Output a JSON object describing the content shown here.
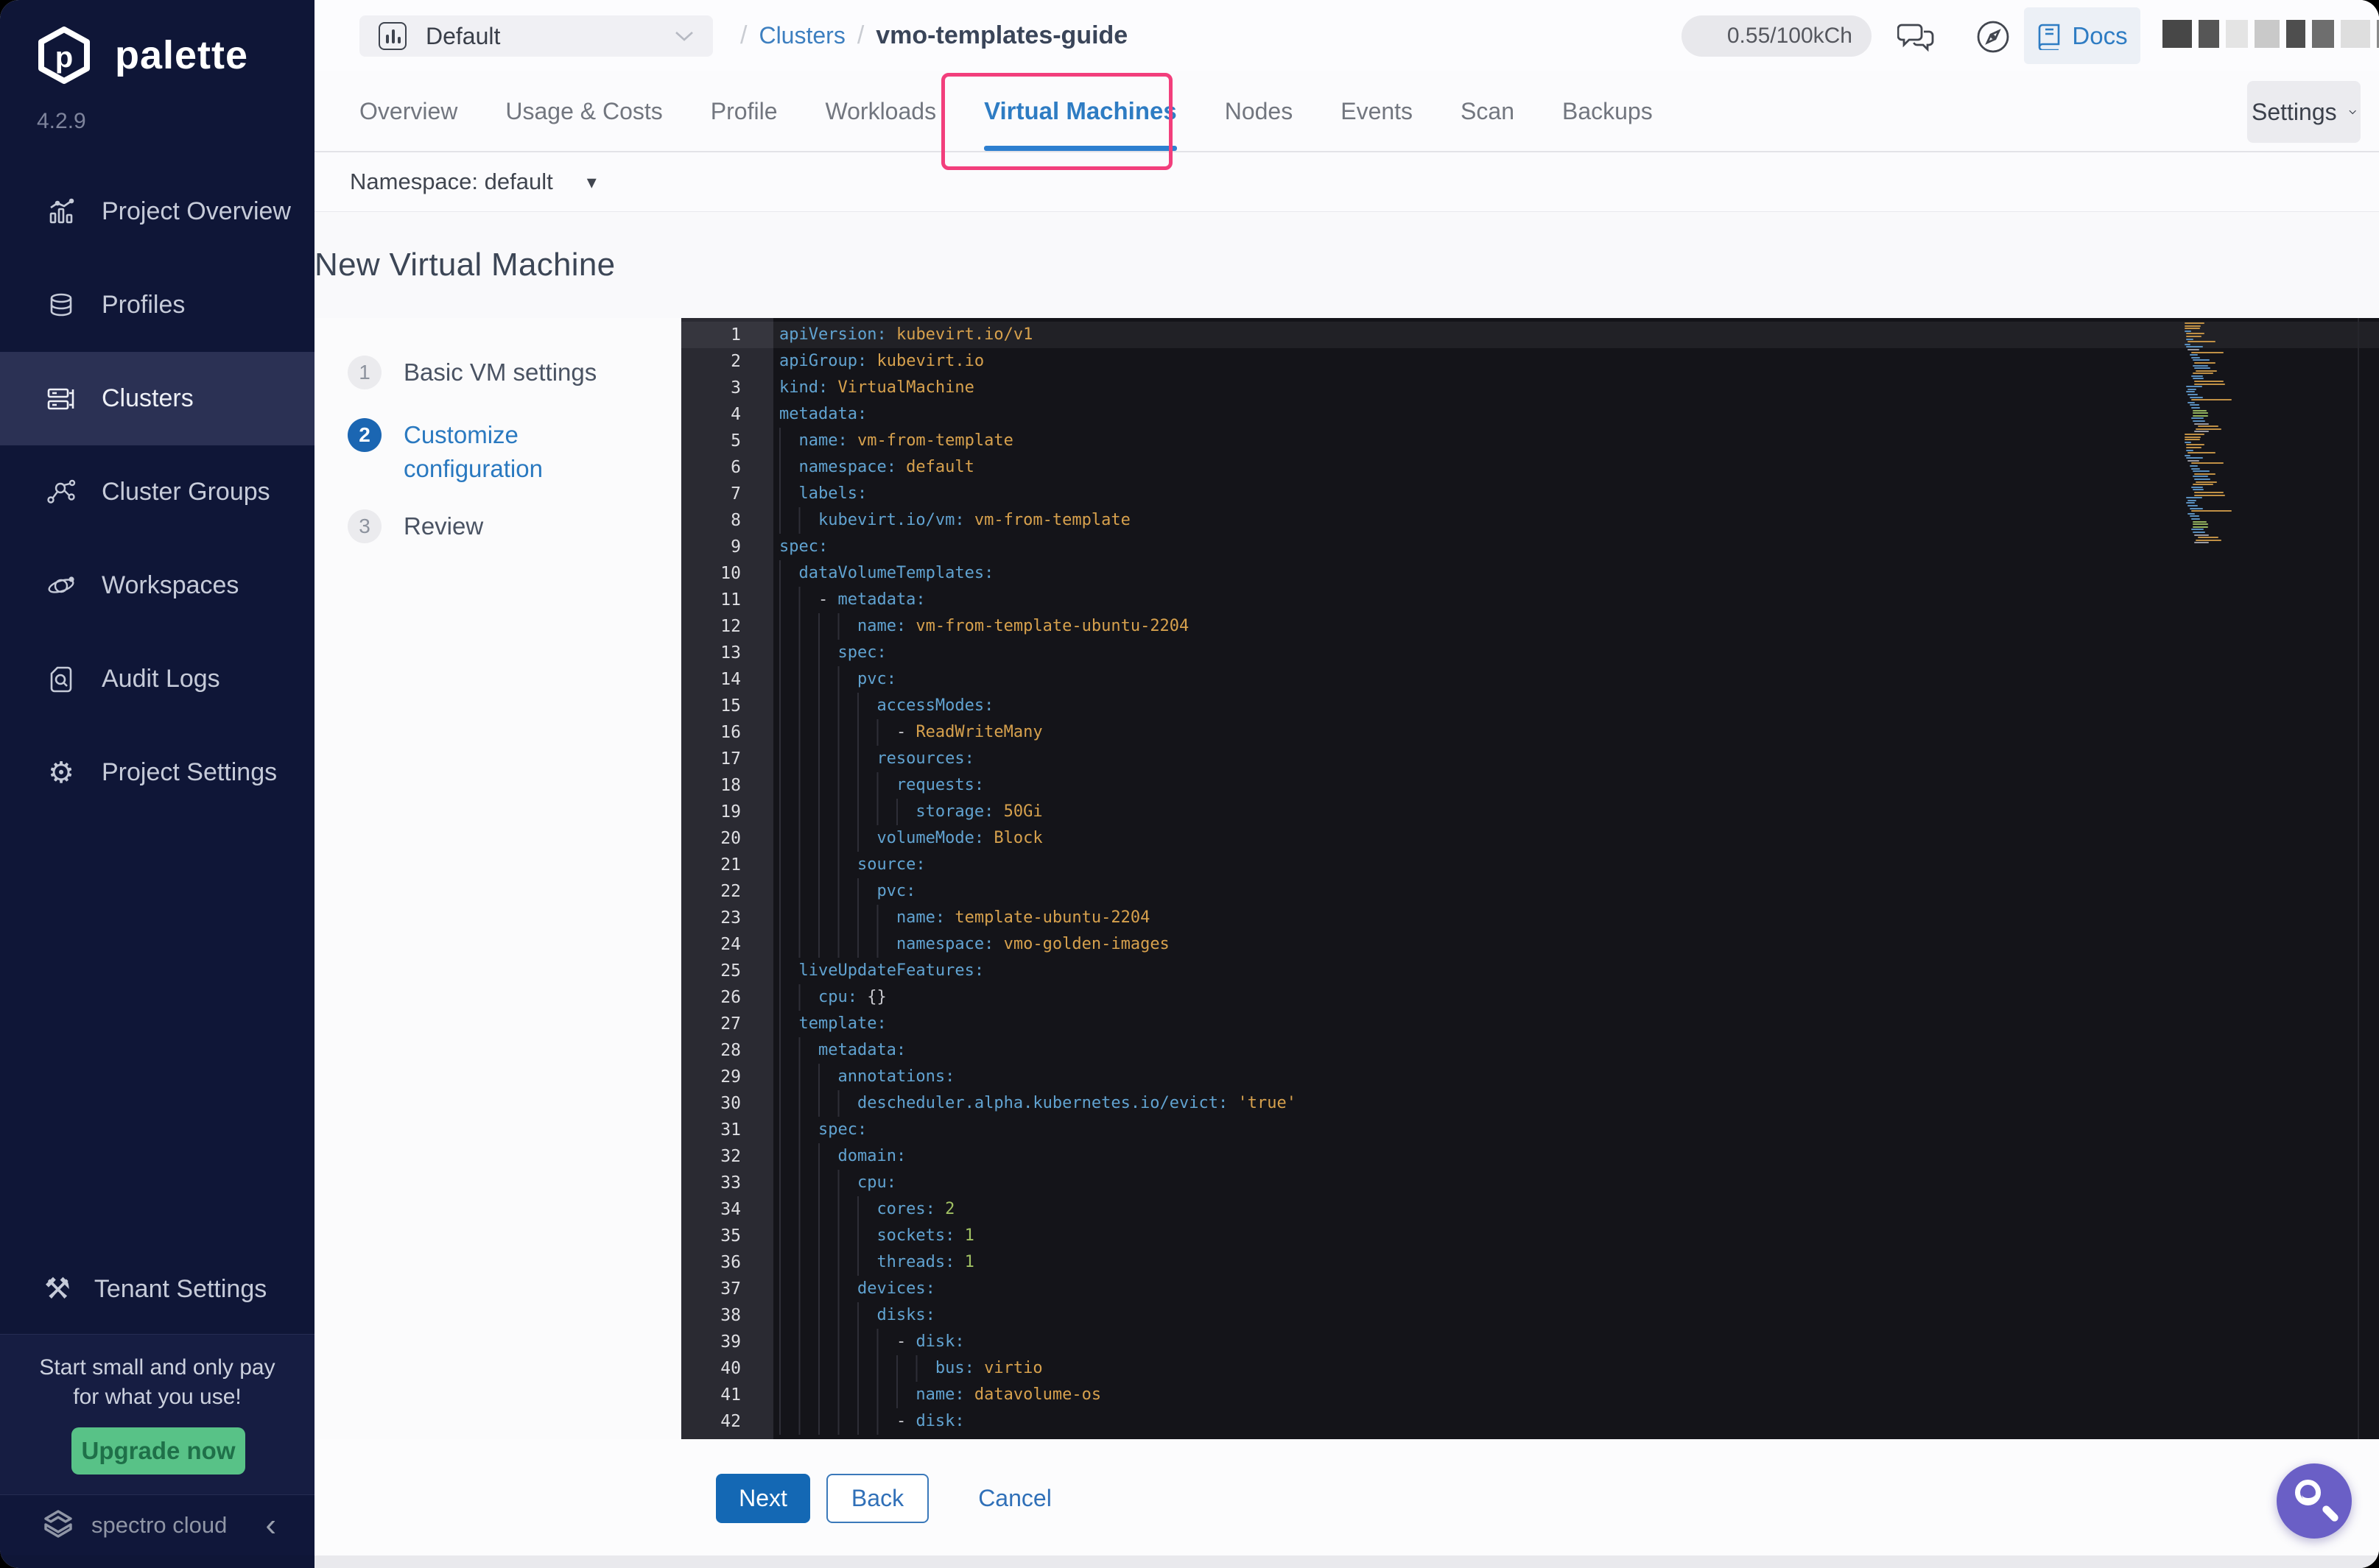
{
  "sidebar": {
    "brand": "palette",
    "version": "4.2.9",
    "items": [
      {
        "label": "Project Overview",
        "icon": "bar-chart-icon",
        "active": false
      },
      {
        "label": "Profiles",
        "icon": "layers-icon",
        "active": false
      },
      {
        "label": "Clusters",
        "icon": "server-icon",
        "active": true
      },
      {
        "label": "Cluster Groups",
        "icon": "network-icon",
        "active": false
      },
      {
        "label": "Workspaces",
        "icon": "orbit-icon",
        "active": false
      },
      {
        "label": "Audit Logs",
        "icon": "audit-search-icon",
        "active": false
      },
      {
        "label": "Project Settings",
        "icon": "gear-icon",
        "active": false
      }
    ],
    "tenant_settings": {
      "label": "Tenant Settings",
      "icon": "tools-icon"
    },
    "upsell": {
      "line1": "Start small and only pay",
      "line2": "for what you use!",
      "button": "Upgrade now",
      "button_color": "#58c287"
    },
    "footer": {
      "brand": "spectro cloud",
      "collapse_icon": "chevron-left-icon"
    }
  },
  "topbar": {
    "project_selector": {
      "value": "Default",
      "icon": "project-chart-icon",
      "caret": "chevron-down-icon"
    },
    "breadcrumb": {
      "separator": "/",
      "section": "Clusters",
      "current": "vmo-templates-guide"
    },
    "usage_badge": "0.55/100kCh",
    "icons": [
      "chat-icon",
      "compass-icon"
    ],
    "docs_button": {
      "label": "Docs",
      "icon": "book-icon"
    }
  },
  "tabs": {
    "items": [
      "Overview",
      "Usage & Costs",
      "Profile",
      "Workloads",
      "Virtual Machines",
      "Nodes",
      "Events",
      "Scan",
      "Backups"
    ],
    "active": "Virtual Machines",
    "active_color": "#2e7cc3",
    "annotation_color": "#f23e7c",
    "settings_button": "Settings"
  },
  "namespace_bar": {
    "label": "Namespace: default"
  },
  "page": {
    "title": "New Virtual Machine"
  },
  "wizard": {
    "active_color": "#1b66b2",
    "steps": [
      {
        "number": "1",
        "label": "Basic VM settings",
        "active": false
      },
      {
        "number": "2",
        "label": "Customize configuration",
        "active": true
      },
      {
        "number": "3",
        "label": "Review",
        "active": false
      }
    ]
  },
  "editor": {
    "active_line": 1,
    "token_colors": {
      "key": "#61a3d1",
      "str": "#d7a14d",
      "num": "#a1c163",
      "plain": "#c9c9ce"
    },
    "lines": [
      {
        "n": 1,
        "i": 0,
        "s": [
          [
            "key",
            "apiVersion:"
          ],
          [
            "str",
            " kubevirt.io/v1"
          ]
        ]
      },
      {
        "n": 2,
        "i": 0,
        "s": [
          [
            "key",
            "apiGroup:"
          ],
          [
            "str",
            " kubevirt.io"
          ]
        ]
      },
      {
        "n": 3,
        "i": 0,
        "s": [
          [
            "key",
            "kind:"
          ],
          [
            "str",
            " VirtualMachine"
          ]
        ]
      },
      {
        "n": 4,
        "i": 0,
        "s": [
          [
            "key",
            "metadata:"
          ]
        ]
      },
      {
        "n": 5,
        "i": 2,
        "s": [
          [
            "key",
            "name:"
          ],
          [
            "str",
            " vm-from-template"
          ]
        ]
      },
      {
        "n": 6,
        "i": 2,
        "s": [
          [
            "key",
            "namespace:"
          ],
          [
            "str",
            " default"
          ]
        ]
      },
      {
        "n": 7,
        "i": 2,
        "s": [
          [
            "key",
            "labels:"
          ]
        ]
      },
      {
        "n": 8,
        "i": 4,
        "s": [
          [
            "key",
            "kubevirt.io/vm:"
          ],
          [
            "str",
            " vm-from-template"
          ]
        ]
      },
      {
        "n": 9,
        "i": 0,
        "s": [
          [
            "key",
            "spec:"
          ]
        ]
      },
      {
        "n": 10,
        "i": 2,
        "s": [
          [
            "key",
            "dataVolumeTemplates:"
          ]
        ]
      },
      {
        "n": 11,
        "i": 4,
        "s": [
          [
            "plain",
            "- "
          ],
          [
            "key",
            "metadata:"
          ]
        ]
      },
      {
        "n": 12,
        "i": 8,
        "s": [
          [
            "key",
            "name:"
          ],
          [
            "str",
            " vm-from-template-ubuntu-2204"
          ]
        ]
      },
      {
        "n": 13,
        "i": 6,
        "s": [
          [
            "key",
            "spec:"
          ]
        ]
      },
      {
        "n": 14,
        "i": 8,
        "s": [
          [
            "key",
            "pvc:"
          ]
        ]
      },
      {
        "n": 15,
        "i": 10,
        "s": [
          [
            "key",
            "accessModes:"
          ]
        ]
      },
      {
        "n": 16,
        "i": 12,
        "s": [
          [
            "plain",
            "- "
          ],
          [
            "str",
            "ReadWriteMany"
          ]
        ]
      },
      {
        "n": 17,
        "i": 10,
        "s": [
          [
            "key",
            "resources:"
          ]
        ]
      },
      {
        "n": 18,
        "i": 12,
        "s": [
          [
            "key",
            "requests:"
          ]
        ]
      },
      {
        "n": 19,
        "i": 14,
        "s": [
          [
            "key",
            "storage:"
          ],
          [
            "str",
            " 50Gi"
          ]
        ]
      },
      {
        "n": 20,
        "i": 10,
        "s": [
          [
            "key",
            "volumeMode:"
          ],
          [
            "str",
            " Block"
          ]
        ]
      },
      {
        "n": 21,
        "i": 8,
        "s": [
          [
            "key",
            "source:"
          ]
        ]
      },
      {
        "n": 22,
        "i": 10,
        "s": [
          [
            "key",
            "pvc:"
          ]
        ]
      },
      {
        "n": 23,
        "i": 12,
        "s": [
          [
            "key",
            "name:"
          ],
          [
            "str",
            " template-ubuntu-2204"
          ]
        ]
      },
      {
        "n": 24,
        "i": 12,
        "s": [
          [
            "key",
            "namespace:"
          ],
          [
            "str",
            " vmo-golden-images"
          ]
        ]
      },
      {
        "n": 25,
        "i": 2,
        "s": [
          [
            "key",
            "liveUpdateFeatures:"
          ]
        ]
      },
      {
        "n": 26,
        "i": 4,
        "s": [
          [
            "key",
            "cpu:"
          ],
          [
            "plain",
            " {}"
          ]
        ]
      },
      {
        "n": 27,
        "i": 2,
        "s": [
          [
            "key",
            "template:"
          ]
        ]
      },
      {
        "n": 28,
        "i": 4,
        "s": [
          [
            "key",
            "metadata:"
          ]
        ]
      },
      {
        "n": 29,
        "i": 6,
        "s": [
          [
            "key",
            "annotations:"
          ]
        ]
      },
      {
        "n": 30,
        "i": 8,
        "s": [
          [
            "key",
            "descheduler.alpha.kubernetes.io/evict:"
          ],
          [
            "str",
            " 'true'"
          ]
        ]
      },
      {
        "n": 31,
        "i": 4,
        "s": [
          [
            "key",
            "spec:"
          ]
        ]
      },
      {
        "n": 32,
        "i": 6,
        "s": [
          [
            "key",
            "domain:"
          ]
        ]
      },
      {
        "n": 33,
        "i": 8,
        "s": [
          [
            "key",
            "cpu:"
          ]
        ]
      },
      {
        "n": 34,
        "i": 10,
        "s": [
          [
            "key",
            "cores:"
          ],
          [
            "num",
            " 2"
          ]
        ]
      },
      {
        "n": 35,
        "i": 10,
        "s": [
          [
            "key",
            "sockets:"
          ],
          [
            "num",
            " 1"
          ]
        ]
      },
      {
        "n": 36,
        "i": 10,
        "s": [
          [
            "key",
            "threads:"
          ],
          [
            "num",
            " 1"
          ]
        ]
      },
      {
        "n": 37,
        "i": 8,
        "s": [
          [
            "key",
            "devices:"
          ]
        ]
      },
      {
        "n": 38,
        "i": 10,
        "s": [
          [
            "key",
            "disks:"
          ]
        ]
      },
      {
        "n": 39,
        "i": 12,
        "s": [
          [
            "plain",
            "- "
          ],
          [
            "key",
            "disk:"
          ]
        ]
      },
      {
        "n": 40,
        "i": 16,
        "s": [
          [
            "key",
            "bus:"
          ],
          [
            "str",
            " virtio"
          ]
        ]
      },
      {
        "n": 41,
        "i": 14,
        "s": [
          [
            "key",
            "name:"
          ],
          [
            "str",
            " datavolume-os"
          ]
        ]
      },
      {
        "n": 42,
        "i": 12,
        "s": [
          [
            "plain",
            "- "
          ],
          [
            "key",
            "disk:"
          ]
        ]
      }
    ]
  },
  "footer_bar": {
    "next": "Next",
    "back": "Back",
    "cancel": "Cancel"
  },
  "fab": {
    "icon": "search-icon",
    "color": "#6a5fc6"
  }
}
